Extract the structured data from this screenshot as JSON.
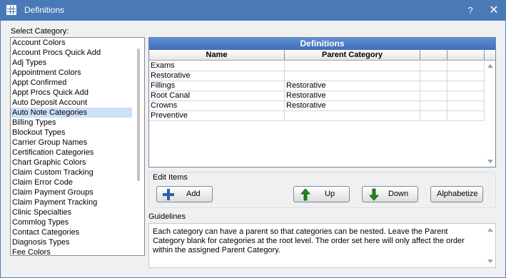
{
  "window": {
    "title": "Definitions",
    "help_label": "?",
    "close_label": "✕",
    "icon": "grid-icon"
  },
  "category": {
    "label": "Select Category:",
    "items": [
      "Account Colors",
      "Account Procs Quick Add",
      "Adj Types",
      "Appointment Colors",
      "Appt Confirmed",
      "Appt Procs Quick Add",
      "Auto Deposit Account",
      "Auto Note Categories",
      "Billing Types",
      "Blockout Types",
      "Carrier Group Names",
      "Certification Categories",
      "Chart Graphic Colors",
      "Claim Custom Tracking",
      "Claim Error Code",
      "Claim Payment Groups",
      "Claim Payment Tracking",
      "Clinic Specialties",
      "Commlog Types",
      "Contact Categories",
      "Diagnosis Types",
      "Fee Colors"
    ],
    "selected": "Auto Note Categories"
  },
  "grid": {
    "title": "Definitions",
    "columns": [
      "Name",
      "Parent Category"
    ],
    "rows": [
      [
        "Exams",
        ""
      ],
      [
        "Restorative",
        ""
      ],
      [
        "Fillings",
        "Restorative"
      ],
      [
        "Root Canal",
        "Restorative"
      ],
      [
        "Crowns",
        "Restorative"
      ],
      [
        "Preventive",
        ""
      ]
    ]
  },
  "edit_items": {
    "label": "Edit Items",
    "add_label": "Add",
    "up_label": "Up",
    "down_label": "Down",
    "alphabetize_label": "Alphabetize",
    "add_icon": "plus-icon",
    "up_icon": "arrow-up-icon",
    "down_icon": "arrow-down-icon"
  },
  "guidelines": {
    "label": "Guidelines",
    "text": "Each category can have a parent so that categories can be nested. Leave the Parent Category blank for categories at the root level. The order set here will only affect the order within the assigned Parent Category."
  },
  "colors": {
    "titlebar": "#4a79b8",
    "grid_header": "#4a7cc7",
    "selection": "#cce0f6",
    "add_icon": "#2e5fa3",
    "arrow_icon": "#1c8a1c"
  }
}
